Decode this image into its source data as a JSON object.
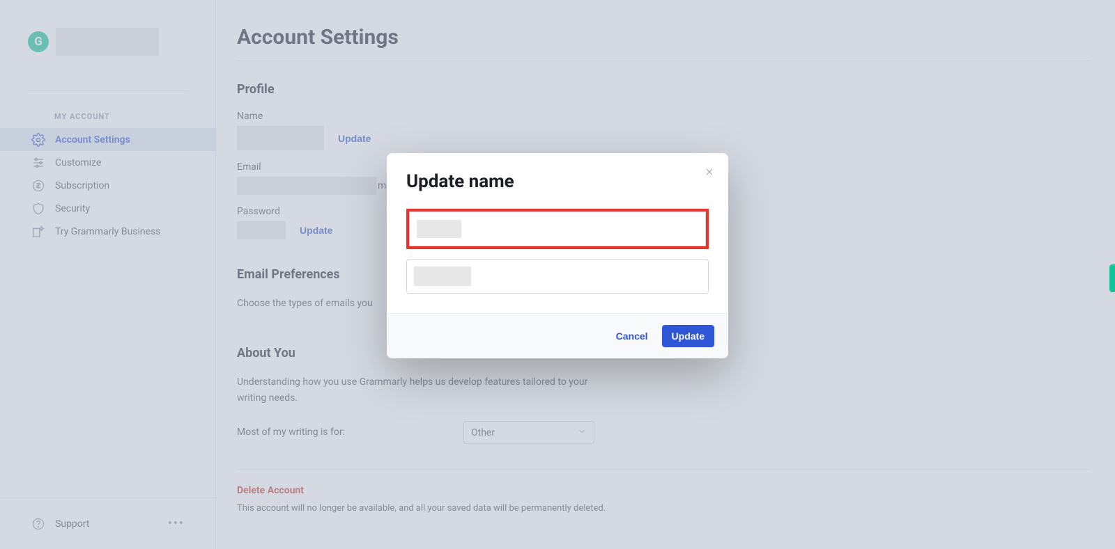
{
  "sidebar": {
    "logo_letter": "G",
    "section_title": "MY ACCOUNT",
    "items": [
      {
        "label": "Account Settings"
      },
      {
        "label": "Customize"
      },
      {
        "label": "Subscription"
      },
      {
        "label": "Security"
      },
      {
        "label": "Try Grammarly Business"
      }
    ],
    "footer": {
      "support": "Support"
    }
  },
  "main": {
    "page_title": "Account Settings",
    "profile": {
      "heading": "Profile",
      "name_label": "Name",
      "name_update": "Update",
      "email_label": "Email",
      "email_visible_fragment": "m",
      "password_label": "Password",
      "password_update": "Update"
    },
    "email_prefs": {
      "heading": "Email Preferences",
      "blurb_visible": "Choose the types of emails you"
    },
    "about": {
      "heading": "About You",
      "blurb": "Understanding how you use Grammarly helps us develop features tailored to your writing needs.",
      "prompt": "Most of my writing is for:",
      "select_value": "Other"
    },
    "delete": {
      "heading": "Delete Account",
      "blurb": "This account will no longer be available, and all your saved data will be permanently deleted."
    }
  },
  "modal": {
    "title": "Update name",
    "cancel": "Cancel",
    "submit": "Update"
  }
}
